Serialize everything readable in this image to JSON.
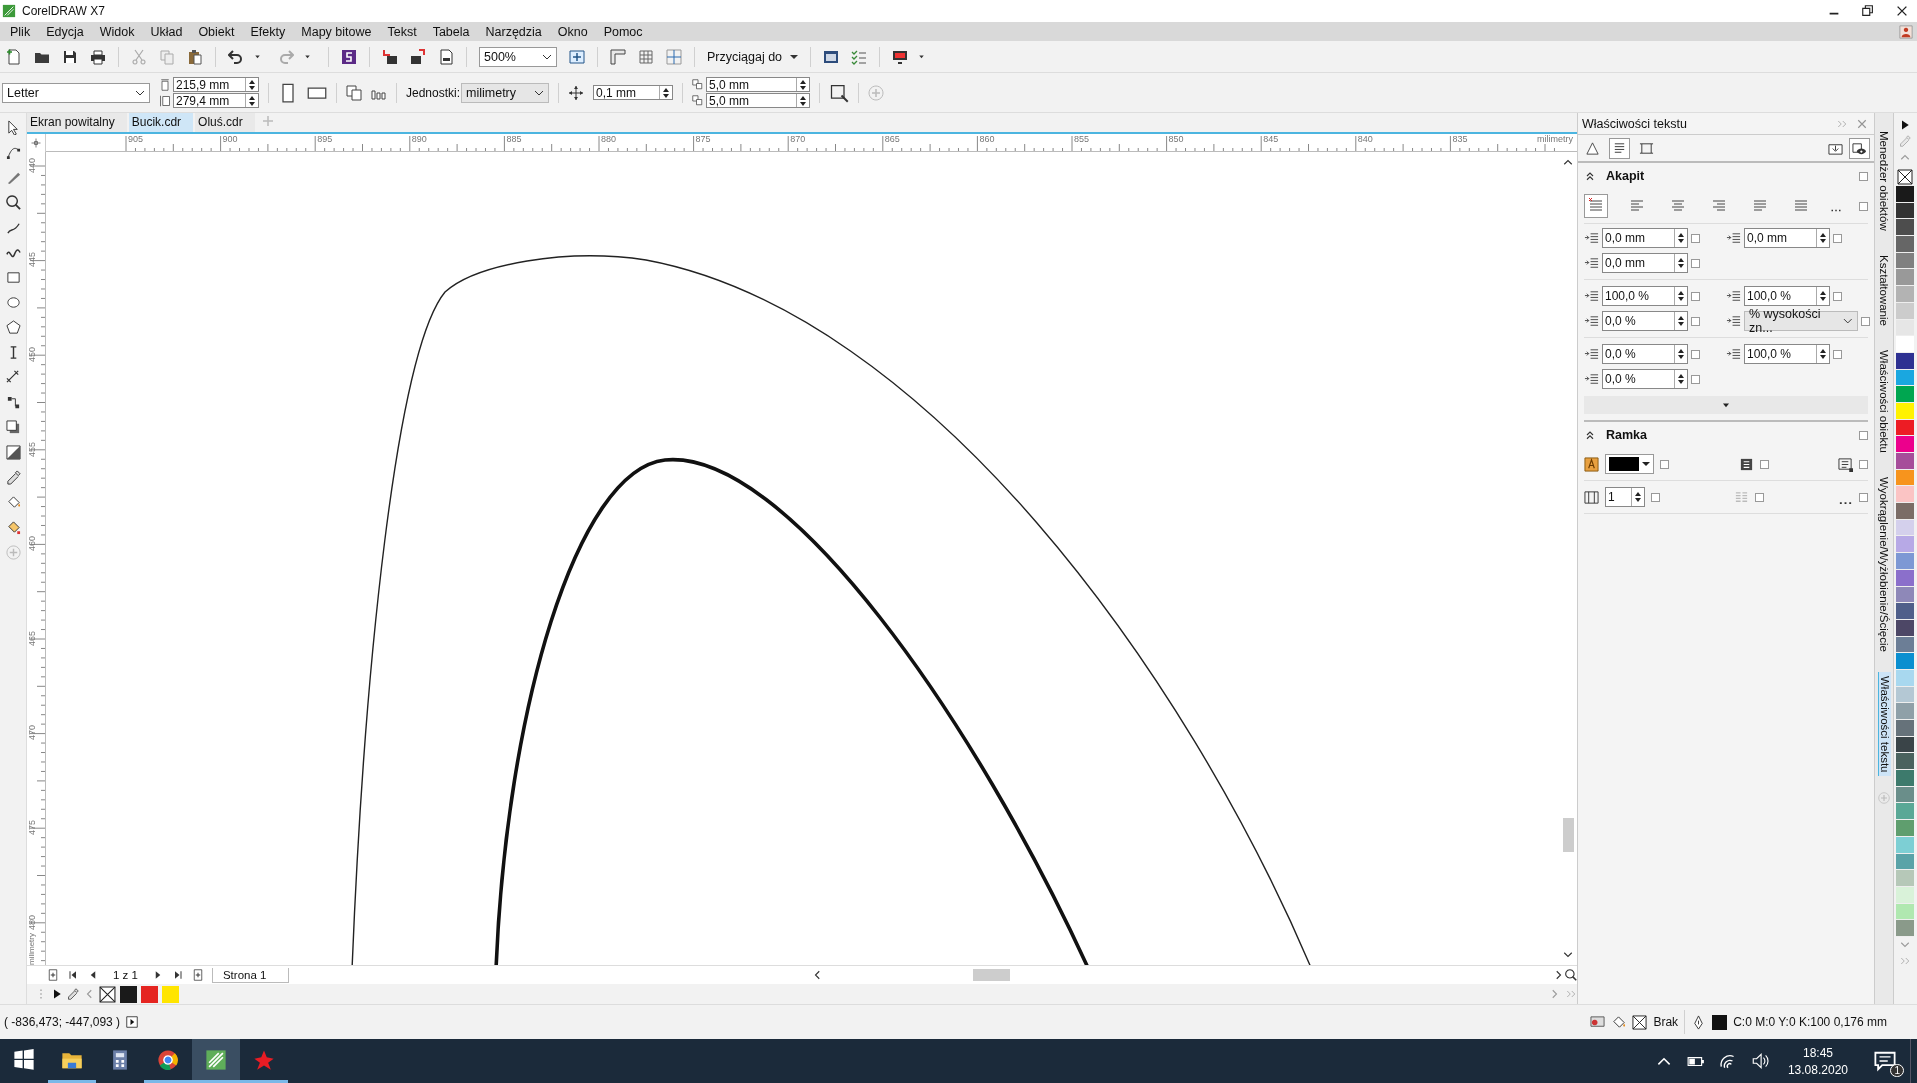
{
  "window": {
    "title": "CorelDRAW X7"
  },
  "menu": [
    "Plik",
    "Edycja",
    "Widok",
    "Układ",
    "Obiekt",
    "Efekty",
    "Mapy bitowe",
    "Tekst",
    "Tabela",
    "Narzędzia",
    "Okno",
    "Pomoc"
  ],
  "toolbar": {
    "zoom": "500%",
    "snap": "Przyciągaj do"
  },
  "property_bar": {
    "page_size": "Letter",
    "width": "215,9 mm",
    "height": "279,4 mm",
    "units_label": "Jednostki:",
    "units": "milimetry",
    "nudge": "0,1 mm",
    "duplicate_x": "5,0 mm",
    "duplicate_y": "5,0 mm"
  },
  "document_tabs": [
    {
      "label": "Ekran powitalny",
      "selected": false
    },
    {
      "label": "Bucik.cdr",
      "selected": true
    },
    {
      "label": "Oluś.cdr",
      "selected": false
    }
  ],
  "horizontal_ruler": {
    "labels": [
      "905",
      "900",
      "895",
      "890",
      "885",
      "880",
      "875",
      "870",
      "865",
      "860",
      "855",
      "850",
      "845",
      "840",
      "835"
    ],
    "unit": "milimetry"
  },
  "vertical_ruler": {
    "labels": [
      "440",
      "445",
      "450",
      "455",
      "460",
      "465",
      "470",
      "475",
      "480"
    ],
    "unit": "milimetry"
  },
  "page_navigator": {
    "count": "1 z 1",
    "pages": [
      {
        "label": "Strona 1",
        "selected": true
      }
    ]
  },
  "document_palette": [
    {
      "color": "#1a1a1a"
    },
    {
      "color": "#e52521"
    },
    {
      "color": "#ffe500"
    }
  ],
  "status_bar": {
    "coordinates": "( -836,473; -447,093 )",
    "fill": "Brak",
    "outline": "C:0 M:0 Y:0 K:100  0,176 mm"
  },
  "docker": {
    "title": "Właściwości tekstu",
    "view_tabs": [
      {
        "kind": "character",
        "selected": false
      },
      {
        "kind": "paragraph",
        "selected": true
      },
      {
        "kind": "frame",
        "selected": false
      }
    ],
    "paragraph": {
      "title": "Akapit",
      "expanded": true,
      "checked": false,
      "alignment_checked": false,
      "alignments": [
        {
          "kind": "none",
          "selected": true
        },
        {
          "kind": "left",
          "selected": false
        },
        {
          "kind": "center",
          "selected": false
        },
        {
          "kind": "right",
          "selected": false
        },
        {
          "kind": "full",
          "selected": false
        },
        {
          "kind": "force-full",
          "selected": false
        }
      ],
      "rows": [
        [
          {
            "kind": "first-line-indent",
            "value": "0,0 mm",
            "checked": false
          },
          {
            "kind": "left-indent",
            "value": "0,0 mm",
            "checked": false
          }
        ],
        [
          {
            "kind": "right-indent",
            "value": "0,0 mm",
            "checked": false
          }
        ],
        [
          {
            "kind": "space-before",
            "value": "100,0 %",
            "checked": false
          },
          {
            "kind": "line-spacing",
            "value": "100,0 %",
            "checked": false
          }
        ],
        [
          {
            "kind": "space-after",
            "value": "0,0 %",
            "checked": false
          },
          {
            "kind": "spacing-unit",
            "value": "% wysokości zn...",
            "checked": false
          }
        ],
        [
          {
            "kind": "character-spacing",
            "value": "0,0 %",
            "checked": false
          },
          {
            "kind": "word-spacing",
            "value": "100,0 %",
            "checked": false
          }
        ],
        [
          {
            "kind": "language-spacing",
            "value": "0,0 %",
            "checked": false
          }
        ]
      ]
    },
    "frame": {
      "title": "Ramka",
      "expanded": true,
      "checked": false,
      "background_checked": false,
      "vertical_align_checked": false,
      "frame_options_checked": false,
      "columns": "1",
      "columns_checked": false,
      "equal_width_checked": false,
      "more_checked": false
    }
  },
  "docker_tabs": [
    {
      "label": "Menedżer obiektów",
      "selected": false
    },
    {
      "label": "Kształtowanie",
      "selected": false
    },
    {
      "label": "Właściwości obiektu",
      "selected": false
    },
    {
      "label": "Wyokrąglenie/Wyżłobienie/Ścięcie",
      "selected": false
    },
    {
      "label": "Właściwości tekstu",
      "selected": true
    }
  ],
  "color_palette": [
    {
      "color": "#1a1a1a"
    },
    {
      "color": "#333333"
    },
    {
      "color": "#4d4d4d"
    },
    {
      "color": "#666666"
    },
    {
      "color": "#808080"
    },
    {
      "color": "#999999"
    },
    {
      "color": "#b3b3b3"
    },
    {
      "color": "#cccccc"
    },
    {
      "color": "#e6e6e6"
    },
    {
      "color": "#ffffff"
    },
    {
      "color": "#2e3192"
    },
    {
      "color": "#1aa7e0"
    },
    {
      "color": "#00a650"
    },
    {
      "color": "#fff200"
    },
    {
      "color": "#ed1c24"
    },
    {
      "color": "#ec008c"
    },
    {
      "color": "#a64d9a"
    },
    {
      "color": "#f7941d"
    },
    {
      "color": "#fbc4c4"
    },
    {
      "color": "#7b6d66"
    },
    {
      "color": "#d4d0ec"
    },
    {
      "color": "#b7a9e6"
    },
    {
      "color": "#7d98d4"
    },
    {
      "color": "#8b6fcb"
    },
    {
      "color": "#8e88b8"
    },
    {
      "color": "#4f5f8a"
    },
    {
      "color": "#4d4766"
    },
    {
      "color": "#6c7e96"
    },
    {
      "color": "#0b8fd0"
    },
    {
      "color": "#a8d8ef"
    },
    {
      "color": "#b4c8d4"
    },
    {
      "color": "#8fa0a8"
    },
    {
      "color": "#66727a"
    },
    {
      "color": "#3a4448"
    },
    {
      "color": "#4a625e"
    },
    {
      "color": "#3d7a6c"
    },
    {
      "color": "#6a8e8a"
    },
    {
      "color": "#5aa896"
    },
    {
      "color": "#5f9e6e"
    },
    {
      "color": "#7dcfd4"
    },
    {
      "color": "#5aa3a8"
    },
    {
      "color": "#b6c8b8"
    },
    {
      "color": "#d9f2d9"
    },
    {
      "color": "#b0e8b0"
    },
    {
      "color": "#8a9a8a"
    }
  ],
  "taskbar": {
    "apps": [
      {
        "kind": "folder",
        "running": true,
        "active": false
      },
      {
        "kind": "calculator",
        "running": false,
        "active": false
      },
      {
        "kind": "browser",
        "running": true,
        "active": false
      },
      {
        "kind": "vector",
        "running": true,
        "active": true
      },
      {
        "kind": "star",
        "running": true,
        "active": false
      }
    ],
    "time": "18:45",
    "date": "13.08.2020",
    "notifications": "1"
  }
}
